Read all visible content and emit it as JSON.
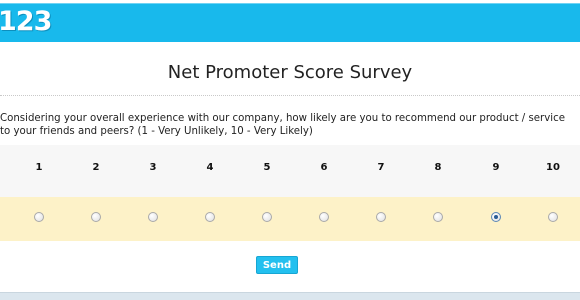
{
  "brand": {
    "logo_text": "123",
    "accent_color": "#18b9ec"
  },
  "survey": {
    "title": "Net Promoter Score Survey",
    "question": "Considering your overall experience with our company, how likely are you to recommend our product / service to your friends and peers? (1 - Very Unlikely, 10 - Very Likely)",
    "scale": [
      "1",
      "2",
      "3",
      "4",
      "5",
      "6",
      "7",
      "8",
      "9",
      "10"
    ],
    "selected": "9"
  },
  "actions": {
    "send_label": "Send"
  }
}
